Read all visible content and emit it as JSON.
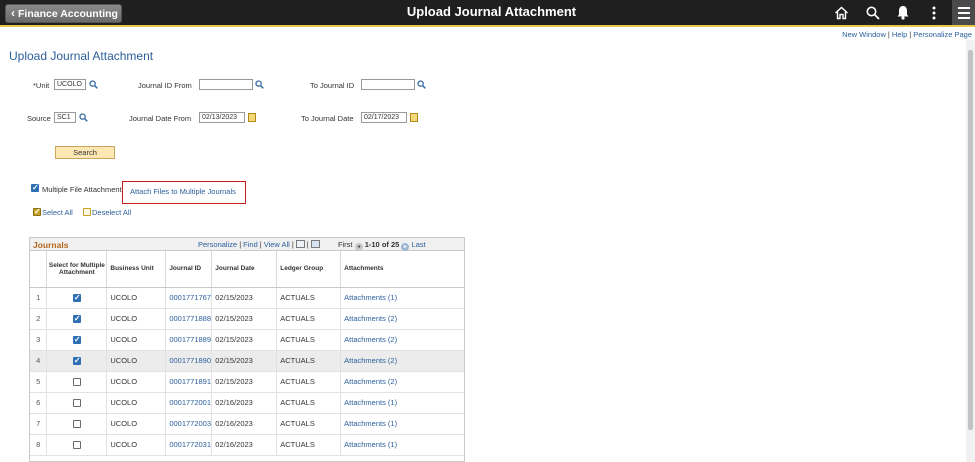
{
  "header": {
    "back_label": "Finance Accounting",
    "title": "Upload Journal Attachment"
  },
  "toplinks": {
    "new_window": "New Window",
    "help": "Help",
    "personalize": "Personalize Page"
  },
  "page_title": "Upload Journal Attachment",
  "form": {
    "unit_label": "*Unit",
    "unit_value": "UCOLO",
    "journal_id_from_label": "Journal ID From",
    "journal_id_from_value": "",
    "to_journal_id_label": "To Journal ID",
    "to_journal_id_value": "",
    "source_label": "Source",
    "source_value": "SC1",
    "journal_date_from_label": "Journal Date From",
    "journal_date_from_value": "02/13/2023",
    "to_journal_date_label": "To Journal Date",
    "to_journal_date_value": "02/17/2023",
    "search_label": "Search"
  },
  "multi_attach": {
    "label": "Multiple File Attachment",
    "checked": true,
    "link": "Attach Files to Multiple Journals",
    "select_all": "Select All",
    "deselect_all": "Deselect All"
  },
  "grid": {
    "title": "Journals",
    "nav": {
      "personalize": "Personalize",
      "find": "Find",
      "view_all": "View All",
      "first": "First",
      "range": "1-10 of 25",
      "last": "Last"
    },
    "columns": [
      "",
      "Select for Multiple Attachment",
      "Business Unit",
      "Journal ID",
      "Journal Date",
      "Ledger Group",
      "Attachments"
    ],
    "rows": [
      {
        "num": "1",
        "checked": true,
        "unit": "UCOLO",
        "journal_id": "0001771767",
        "date": "02/15/2023",
        "ledger": "ACTUALS",
        "attachments": "Attachments (1)"
      },
      {
        "num": "2",
        "checked": true,
        "unit": "UCOLO",
        "journal_id": "0001771888",
        "date": "02/15/2023",
        "ledger": "ACTUALS",
        "attachments": "Attachments (2)"
      },
      {
        "num": "3",
        "checked": true,
        "unit": "UCOLO",
        "journal_id": "0001771889",
        "date": "02/15/2023",
        "ledger": "ACTUALS",
        "attachments": "Attachments (2)"
      },
      {
        "num": "4",
        "checked": true,
        "unit": "UCOLO",
        "journal_id": "0001771890",
        "date": "02/15/2023",
        "ledger": "ACTUALS",
        "attachments": "Attachments (2)"
      },
      {
        "num": "5",
        "checked": false,
        "unit": "UCOLO",
        "journal_id": "0001771891",
        "date": "02/15/2023",
        "ledger": "ACTUALS",
        "attachments": "Attachments (2)"
      },
      {
        "num": "6",
        "checked": false,
        "unit": "UCOLO",
        "journal_id": "0001772001",
        "date": "02/16/2023",
        "ledger": "ACTUALS",
        "attachments": "Attachments (1)"
      },
      {
        "num": "7",
        "checked": false,
        "unit": "UCOLO",
        "journal_id": "0001772003",
        "date": "02/16/2023",
        "ledger": "ACTUALS",
        "attachments": "Attachments (1)"
      },
      {
        "num": "8",
        "checked": false,
        "unit": "UCOLO",
        "journal_id": "0001772031",
        "date": "02/16/2023",
        "ledger": "ACTUALS",
        "attachments": "Attachments (1)"
      }
    ]
  }
}
